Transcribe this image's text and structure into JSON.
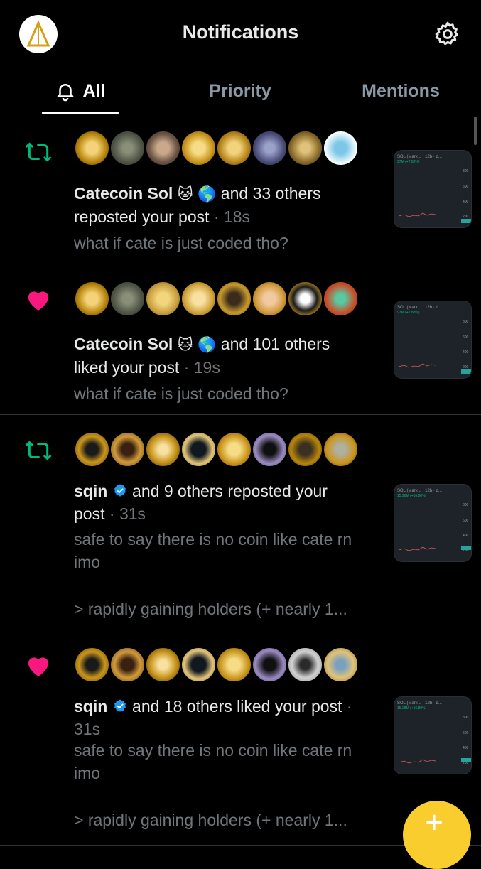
{
  "header": {
    "title": "Notifications"
  },
  "tabs": [
    {
      "label": "All"
    },
    {
      "label": "Priority"
    },
    {
      "label": "Mentions"
    }
  ],
  "notifications": [
    {
      "type": "repost",
      "name": "Catecoin Sol",
      "name_emoji": "🐱 🌎",
      "rest": " and 33 others",
      "action": "reposted your post",
      "time": "18s",
      "snippet": "what if cate is just coded tho?",
      "snippet_more": "",
      "thumb_title": "SOL (Mark... · 12h · d...",
      "thumb_sub": "97M (+7.88%)"
    },
    {
      "type": "like",
      "name": "Catecoin Sol",
      "name_emoji": "🐱 🌎",
      "rest": " and 101 others",
      "action": "liked your post",
      "time": "19s",
      "snippet": "what if cate is just coded tho?",
      "snippet_more": "",
      "thumb_title": "SOL (Mark... · 12h · d...",
      "thumb_sub": "97M (+7.88%)"
    },
    {
      "type": "repost",
      "name": "sqin",
      "rest": " and 9 others reposted your",
      "action": "post",
      "time": "31s",
      "snippet": "safe to say there is no coin like cate rn imo",
      "snippet_more": "> rapidly gaining holders (+ nearly 1...",
      "thumb_title": "SOL (Mark... · 12h · d...",
      "thumb_sub": "15.28M (+16.80%)"
    },
    {
      "type": "like",
      "name": "sqin",
      "rest": " and 18 others liked your post",
      "action": "",
      "time": "31s",
      "snippet": "safe to say there is no coin like cate rn imo",
      "snippet_more": "> rapidly gaining holders (+ nearly 1...",
      "thumb_title": "SOL (Mark... · 12h · d...",
      "thumb_sub": "15.28M (+16.80%)"
    }
  ],
  "thumb_axis": [
    "800",
    "600",
    "400",
    "200"
  ],
  "fab": {
    "label": "+"
  },
  "colors": {
    "repost": "#00ba7c",
    "like": "#f91880",
    "verified": "#1d9bf0",
    "fab": "#f9cd2e"
  }
}
